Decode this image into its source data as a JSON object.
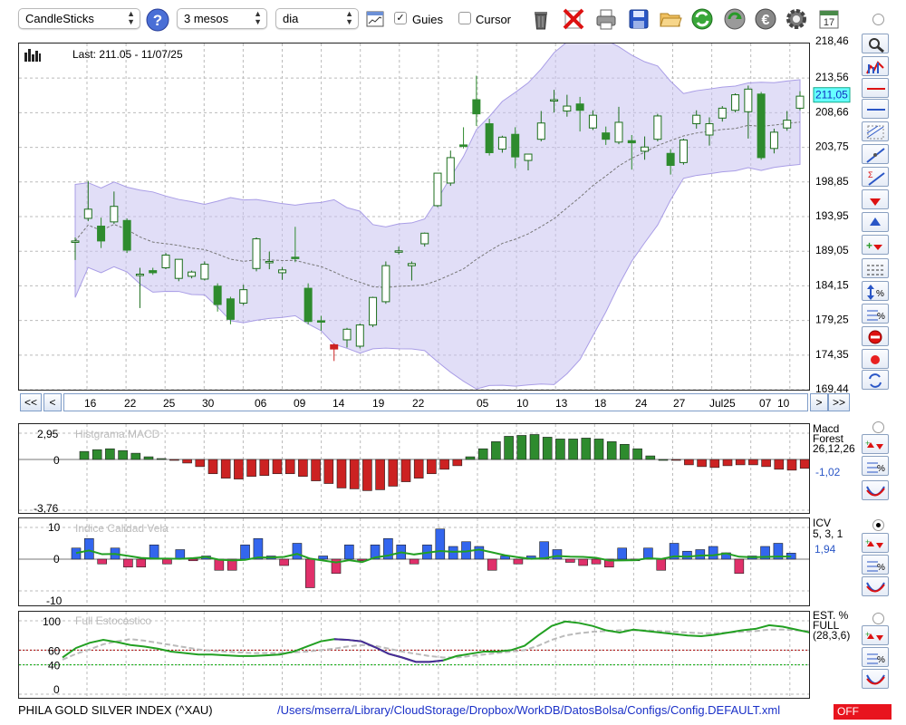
{
  "toolbar": {
    "chart_type": "CandleSticks",
    "period": "3 mesos",
    "interval": "dia",
    "guides_label": "Guies",
    "guides_checked": true,
    "cursor_label": "Cursor",
    "cursor_checked": false,
    "calendar_day": "17",
    "icons": [
      "help-icon",
      "chart-settings-icon",
      "trash-icon",
      "delete-icon",
      "print-icon",
      "save-icon",
      "open-folder-icon",
      "refresh-icon",
      "reload-icon",
      "euro-icon",
      "gear-icon",
      "calendar-icon"
    ]
  },
  "price": {
    "last_label": "Last: 211.05 - 11/07/25",
    "current_value": "211,05",
    "y_ticks": [
      "213,56",
      "208,66",
      "203,75",
      "198,85",
      "193,95",
      "189,05",
      "184,15",
      "179,25",
      "174,35",
      "169,44"
    ],
    "y_top_cut": "218,46",
    "x_ticks": [
      "16",
      "22",
      "25",
      "30",
      "06",
      "09",
      "14",
      "19",
      "22",
      "05",
      "10",
      "13",
      "18",
      "24",
      "27",
      "Jul25",
      "07",
      "10"
    ],
    "nav": {
      "first": "<<",
      "prev": "<",
      "next": ">",
      "last": ">>"
    }
  },
  "macd": {
    "title": "Histgrama MACD",
    "y_ticks": [
      "2,95",
      "0",
      "-3,76"
    ],
    "legend": [
      "Macd",
      "Forest",
      "26,12,26"
    ],
    "value": "-1,02"
  },
  "icv": {
    "title": "Indice Calidad Vela",
    "y_ticks": [
      "10",
      "0",
      "-10"
    ],
    "legend": [
      "ICV",
      "5, 3, 1"
    ],
    "value": "1,94"
  },
  "stoch": {
    "title": "Full Estocastico",
    "y_ticks": [
      "100",
      "60",
      "40",
      "0"
    ],
    "legend": [
      "EST. %",
      "FULL",
      "(28,3,6)"
    ]
  },
  "side_tools": [
    "zoom-icon",
    "bars-chart-icon",
    "red-line-icon",
    "blue-line-icon",
    "channel-icon",
    "trendline-icon",
    "fibonacci-icon",
    "arrow-down-icon",
    "arrow-up-icon",
    "buy-sell-icon",
    "grid-lines-icon",
    "percent-range-icon",
    "percent-lines-icon",
    "stop-icon",
    "record-icon",
    "sync-icon"
  ],
  "status": {
    "symbol": "PHILA GOLD  SILVER INDEX (^XAU)",
    "path": "/Users/mserra/Library/CloudStorage/Dropbox/WorkDB/DatosBolsa/Configs/Config.DEFAULT.xml",
    "off_label": "OFF"
  },
  "colors": {
    "up": "#2e8b2e",
    "down": "#cc2222",
    "band": "#c9c2f0",
    "blue": "#3366ee",
    "pink": "#e0306a",
    "stoch": "#22a022"
  },
  "chart_data": {
    "type": "candlestick",
    "y_range": [
      169.44,
      218.46
    ],
    "candles": [
      {
        "o": 190.3,
        "h": 191.0,
        "l": 187.8,
        "c": 190.5
      },
      {
        "o": 193.7,
        "h": 199.0,
        "l": 193.3,
        "c": 195.0
      },
      {
        "o": 192.6,
        "h": 193.8,
        "l": 189.5,
        "c": 190.5
      },
      {
        "o": 193.2,
        "h": 197.5,
        "l": 192.9,
        "c": 195.4
      },
      {
        "o": 193.4,
        "h": 193.7,
        "l": 188.8,
        "c": 189.2
      },
      {
        "o": 185.6,
        "h": 186.7,
        "l": 181.0,
        "c": 185.8
      },
      {
        "o": 186.3,
        "h": 186.7,
        "l": 185.7,
        "c": 186.0
      },
      {
        "o": 186.7,
        "h": 188.8,
        "l": 186.5,
        "c": 188.5
      },
      {
        "o": 185.2,
        "h": 187.8,
        "l": 184.8,
        "c": 187.9
      },
      {
        "o": 185.5,
        "h": 186.3,
        "l": 185.2,
        "c": 186.1
      },
      {
        "o": 185.1,
        "h": 187.6,
        "l": 184.9,
        "c": 187.2
      },
      {
        "o": 184.1,
        "h": 184.5,
        "l": 180.5,
        "c": 181.5
      },
      {
        "o": 182.3,
        "h": 182.6,
        "l": 178.7,
        "c": 179.4
      },
      {
        "o": 181.7,
        "h": 184.3,
        "l": 181.4,
        "c": 183.6
      },
      {
        "o": 186.6,
        "h": 191.0,
        "l": 186.2,
        "c": 190.8
      },
      {
        "o": 187.5,
        "h": 189.0,
        "l": 186.5,
        "c": 187.6
      },
      {
        "o": 186.0,
        "h": 186.8,
        "l": 185.0,
        "c": 186.4
      },
      {
        "o": 188.2,
        "h": 192.5,
        "l": 187.5,
        "c": 188.0
      },
      {
        "o": 183.8,
        "h": 184.5,
        "l": 178.7,
        "c": 179.1
      },
      {
        "o": 179.2,
        "h": 179.9,
        "l": 177.8,
        "c": 179.0
      },
      {
        "o": 175.8,
        "h": 176.0,
        "l": 173.5,
        "c": 175.2
      },
      {
        "o": 176.5,
        "h": 178.2,
        "l": 175.4,
        "c": 178.0
      },
      {
        "o": 175.6,
        "h": 178.8,
        "l": 175.3,
        "c": 178.6
      },
      {
        "o": 178.6,
        "h": 182.6,
        "l": 178.3,
        "c": 182.5
      },
      {
        "o": 181.9,
        "h": 187.6,
        "l": 181.6,
        "c": 187.0
      },
      {
        "o": 189.0,
        "h": 189.7,
        "l": 188.6,
        "c": 189.1
      },
      {
        "o": 187.0,
        "h": 187.6,
        "l": 184.9,
        "c": 187.3
      },
      {
        "o": 190.1,
        "h": 191.7,
        "l": 189.7,
        "c": 191.6
      },
      {
        "o": 195.5,
        "h": 200.1,
        "l": 195.3,
        "c": 200.1
      },
      {
        "o": 198.7,
        "h": 203.3,
        "l": 198.3,
        "c": 202.3
      },
      {
        "o": 204.1,
        "h": 206.6,
        "l": 203.6,
        "c": 203.9
      },
      {
        "o": 210.5,
        "h": 213.9,
        "l": 206.8,
        "c": 208.5
      },
      {
        "o": 207.1,
        "h": 207.8,
        "l": 202.6,
        "c": 203.0
      },
      {
        "o": 203.5,
        "h": 205.4,
        "l": 203.0,
        "c": 205.2
      },
      {
        "o": 205.6,
        "h": 206.6,
        "l": 200.8,
        "c": 202.4
      },
      {
        "o": 201.9,
        "h": 202.3,
        "l": 200.5,
        "c": 202.8
      },
      {
        "o": 204.9,
        "h": 208.9,
        "l": 204.6,
        "c": 207.2
      },
      {
        "o": 210.5,
        "h": 211.9,
        "l": 208.7,
        "c": 210.5
      },
      {
        "o": 208.9,
        "h": 211.2,
        "l": 208.1,
        "c": 209.6
      },
      {
        "o": 209.9,
        "h": 210.9,
        "l": 206.0,
        "c": 209.0
      },
      {
        "o": 206.5,
        "h": 209.0,
        "l": 206.2,
        "c": 208.3
      },
      {
        "o": 205.8,
        "h": 206.7,
        "l": 204.1,
        "c": 204.9
      },
      {
        "o": 204.5,
        "h": 209.5,
        "l": 204.2,
        "c": 207.3
      },
      {
        "o": 204.7,
        "h": 205.5,
        "l": 200.6,
        "c": 204.4
      },
      {
        "o": 203.2,
        "h": 205.3,
        "l": 202.0,
        "c": 203.8
      },
      {
        "o": 204.9,
        "h": 208.5,
        "l": 204.6,
        "c": 208.2
      },
      {
        "o": 202.9,
        "h": 203.5,
        "l": 199.9,
        "c": 201.2
      },
      {
        "o": 201.6,
        "h": 205.0,
        "l": 201.3,
        "c": 204.8
      },
      {
        "o": 207.1,
        "h": 209.0,
        "l": 206.4,
        "c": 208.3
      },
      {
        "o": 205.5,
        "h": 208.0,
        "l": 204.0,
        "c": 207.1
      },
      {
        "o": 207.9,
        "h": 209.6,
        "l": 207.4,
        "c": 209.3
      },
      {
        "o": 209.0,
        "h": 211.4,
        "l": 208.7,
        "c": 211.2
      },
      {
        "o": 208.8,
        "h": 212.5,
        "l": 205.0,
        "c": 212.0
      },
      {
        "o": 211.3,
        "h": 211.6,
        "l": 202.0,
        "c": 202.3
      },
      {
        "o": 203.6,
        "h": 206.4,
        "l": 202.9,
        "c": 205.9
      },
      {
        "o": 206.5,
        "h": 208.9,
        "l": 206.1,
        "c": 207.6
      },
      {
        "o": 209.3,
        "h": 211.7,
        "l": 209.0,
        "c": 211.0
      }
    ],
    "macd_values": [
      0.9,
      1.1,
      1.2,
      1.0,
      0.7,
      0.3,
      0.1,
      -0.1,
      -0.4,
      -0.8,
      -1.6,
      -2.1,
      -2.2,
      -1.9,
      -1.8,
      -1.6,
      -1.6,
      -1.9,
      -2.4,
      -2.7,
      -3.2,
      -3.3,
      -3.5,
      -3.4,
      -3.0,
      -2.5,
      -2.1,
      -1.6,
      -1.1,
      -0.7,
      0.3,
      1.2,
      2.0,
      2.6,
      2.7,
      2.8,
      2.5,
      2.3,
      2.3,
      2.4,
      2.3,
      2.0,
      1.7,
      1.2,
      0.4,
      0.0,
      -0.1,
      -0.6,
      -0.8,
      -0.9,
      -0.7,
      -0.6,
      -0.6,
      -0.8,
      -1.1,
      -1.2,
      -1.0
    ],
    "icv_values": [
      3.5,
      6.5,
      -1.5,
      3.5,
      -2.5,
      -2.5,
      4.5,
      -1.5,
      3.0,
      -0.5,
      1.0,
      -3.5,
      -3.5,
      4.5,
      6.5,
      1.0,
      -2.0,
      5.0,
      -9.0,
      1.0,
      -4.5,
      4.5,
      -0.5,
      4.5,
      6.5,
      4.5,
      -1.5,
      4.5,
      9.5,
      4.0,
      5.5,
      4.0,
      -3.5,
      1.0,
      -1.5,
      1.0,
      5.5,
      3.0,
      -1.0,
      -2.0,
      -1.5,
      -2.5,
      3.5,
      -0.5,
      3.5,
      -3.5,
      5.0,
      2.5,
      3.0,
      4.0,
      2.0,
      -4.5,
      1.0,
      4.0,
      5.0,
      1.9
    ],
    "stoch_full": [
      50,
      63,
      70,
      74,
      71,
      67,
      65,
      62,
      58,
      56,
      54,
      54,
      53,
      52,
      52,
      53,
      54,
      58,
      65,
      72,
      75,
      74,
      72,
      64,
      55,
      50,
      44,
      44,
      46,
      52,
      55,
      58,
      58,
      60,
      66,
      80,
      93,
      99,
      97,
      93,
      87,
      84,
      88,
      86,
      84,
      82,
      80,
      79,
      81,
      84,
      87,
      89,
      94,
      92,
      88,
      84,
      82
    ],
    "stoch_signal": [
      47,
      55,
      61,
      68,
      72,
      75,
      73,
      70,
      67,
      64,
      61,
      59,
      58,
      57,
      56,
      56,
      56,
      57,
      58,
      60,
      62,
      65,
      67,
      66,
      62,
      58,
      55,
      52,
      50,
      50,
      52,
      54,
      56,
      58,
      60,
      66,
      74,
      80,
      83,
      85,
      86,
      87,
      87,
      87,
      86,
      85,
      84,
      83,
      83,
      84,
      85,
      86,
      88,
      88,
      87,
      86,
      85
    ]
  }
}
